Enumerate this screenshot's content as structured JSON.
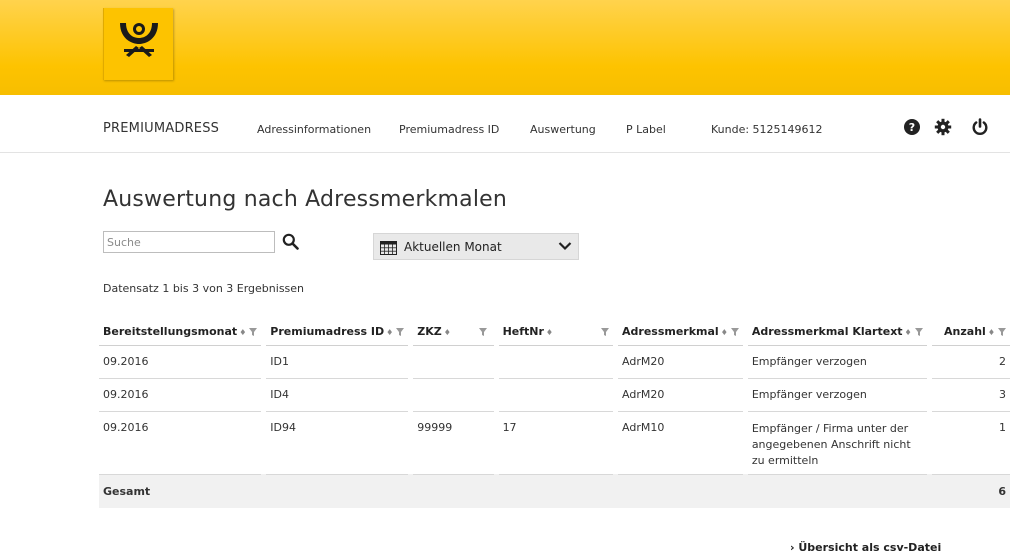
{
  "header": {
    "brand": "PREMIUMADRESS",
    "nav": [
      {
        "label": "Adressinformationen"
      },
      {
        "label": "Premiumadress ID"
      },
      {
        "label": "Auswertung"
      },
      {
        "label": "P Label"
      }
    ],
    "customer": "Kunde: 5125149612",
    "icons": [
      "help-icon",
      "gear-icon",
      "power-icon"
    ]
  },
  "main": {
    "title": "Auswertung nach Adressmerkmalen",
    "search_placeholder": "Suche",
    "period": "Aktuellen Monat",
    "record_count": "Datensatz 1 bis 3 von 3 Ergebnissen"
  },
  "table": {
    "columns": [
      "Bereitstellungsmonat",
      "Premiumadress ID",
      "ZKZ",
      "HeftNr",
      "Adressmerkmal",
      "Adressmerkmal Klartext",
      "Anzahl"
    ],
    "rows": [
      [
        "09.2016",
        "ID1",
        "",
        "",
        "AdrM20",
        "Empfänger verzogen",
        "2"
      ],
      [
        "09.2016",
        "ID4",
        "",
        "",
        "AdrM20",
        "Empfänger verzogen",
        "3"
      ],
      [
        "09.2016",
        "ID94",
        "99999",
        "17",
        "AdrM10",
        "Empfänger / Firma unter der angegebenen Anschrift nicht zu ermitteln",
        "1"
      ]
    ],
    "total_label": "Gesamt",
    "total_value": "6"
  },
  "footer": {
    "csv_link": "› Übersicht als csv-Datei"
  },
  "colors": {
    "brand_yellow": "#fdc300",
    "text": "#333333"
  }
}
